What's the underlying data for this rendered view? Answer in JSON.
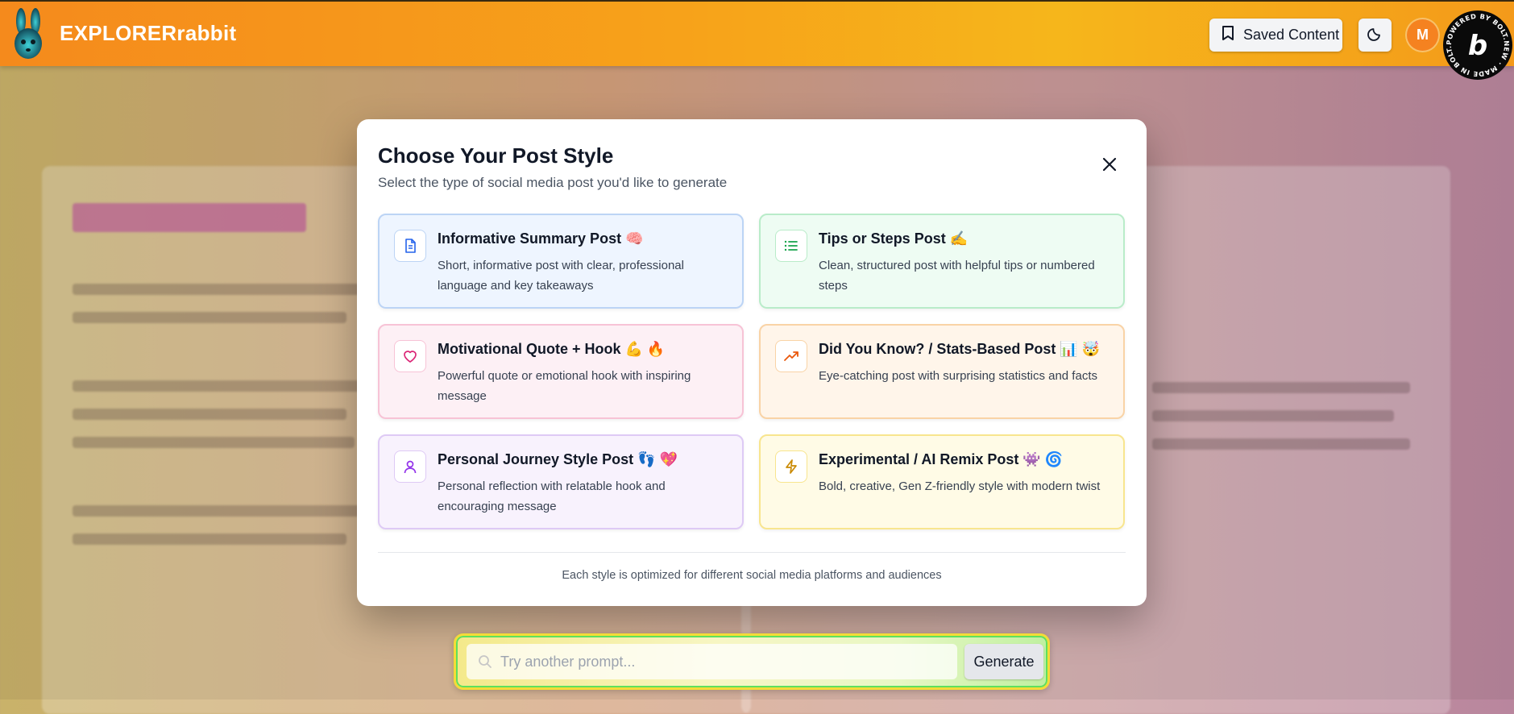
{
  "header": {
    "app_title": "EXPLORERrabbit",
    "saved_content_label": "Saved Content",
    "avatar_initial": "M",
    "badge_text": "POWERED BY BOLT.NEW · MADE IN BOLT.NEW ·"
  },
  "modal": {
    "title": "Choose Your Post Style",
    "subtitle": "Select the type of social media post you'd like to generate",
    "footnote": "Each style is optimized for different social media platforms and audiences",
    "options": [
      {
        "title": "Informative Summary Post 🧠",
        "description": "Short, informative post with clear, professional language and key takeaways",
        "icon": "document-icon",
        "bg": "#eef5ff",
        "border": "#bcd4f5",
        "icon_color": "#2563eb"
      },
      {
        "title": "Tips or Steps Post ✍️",
        "description": "Clean, structured post with helpful tips or numbered steps",
        "icon": "list-icon",
        "bg": "#eefcf3",
        "border": "#b9ecc9",
        "icon_color": "#16a34a"
      },
      {
        "title": "Motivational Quote + Hook 💪 🔥",
        "description": "Powerful quote or emotional hook with inspiring message",
        "icon": "heart-icon",
        "bg": "#fdf0f5",
        "border": "#f7c3d6",
        "icon_color": "#db2777"
      },
      {
        "title": "Did You Know? / Stats-Based Post 📊 🤯",
        "description": "Eye-catching post with surprising statistics and facts",
        "icon": "trending-up-icon",
        "bg": "#fff5ea",
        "border": "#f9d3a6",
        "icon_color": "#ea580c"
      },
      {
        "title": "Personal Journey Style Post 👣 💖",
        "description": "Personal reflection with relatable hook and encouraging message",
        "icon": "user-icon",
        "bg": "#f8f2fd",
        "border": "#decaf5",
        "icon_color": "#9333ea"
      },
      {
        "title": "Experimental / AI Remix Post 👾 🌀",
        "description": "Bold, creative, Gen Z-friendly style with modern twist",
        "icon": "lightning-icon",
        "bg": "#fffbe6",
        "border": "#f8e58e",
        "icon_color": "#ca8a04"
      }
    ]
  },
  "prompt": {
    "placeholder": "Try another prompt...",
    "generate_label": "Generate"
  }
}
